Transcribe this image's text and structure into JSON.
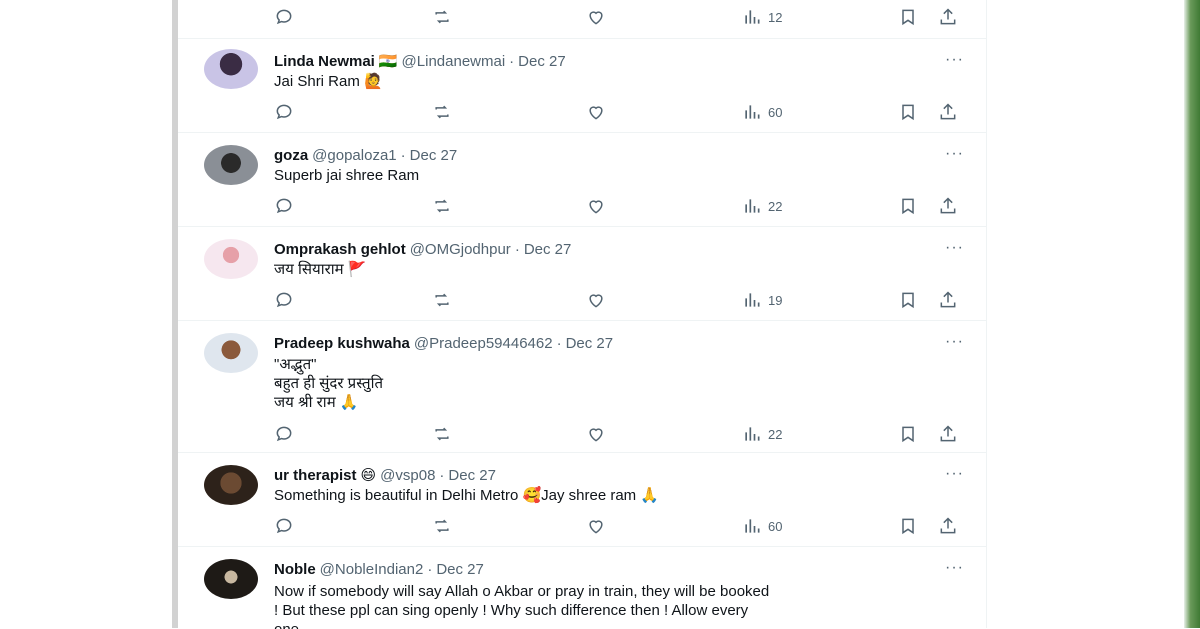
{
  "top_row": {
    "views": "12"
  },
  "posts": [
    {
      "name": "Linda Newmai",
      "badge": "🇮🇳",
      "handle": "@Lindanewmai",
      "date": "Dec 27",
      "text": "Jai Shri Ram 🙋",
      "views": "60"
    },
    {
      "name": "goza",
      "badge": "",
      "handle": "@gopaloza1",
      "date": "Dec 27",
      "text": "Superb jai shree Ram",
      "views": "22"
    },
    {
      "name": "Omprakash gehlot",
      "badge": "",
      "handle": "@OMGjodhpur",
      "date": "Dec 27",
      "text": "जय सियाराम 🚩",
      "views": "19"
    },
    {
      "name": "Pradeep kushwaha",
      "badge": "",
      "handle": "@Pradeep59446462",
      "date": "Dec 27",
      "text": "\"अद्भुत\"\nबहुत ही सुंदर प्रस्तुति\nजय श्री राम 🙏",
      "views": "22"
    },
    {
      "name": "ur therapist",
      "badge": "😄",
      "handle": "@vsp08",
      "date": "Dec 27",
      "text": "Something is beautiful in Delhi Metro 🥰Jay shree ram 🙏",
      "views": "60"
    },
    {
      "name": "Noble",
      "badge": "",
      "handle": "@NobleIndian2",
      "date": "Dec 27",
      "text": "Now if somebody will say Allah o Akbar or pray in train, they will be booked\n! But these ppl can sing openly ! Why such difference then ! Allow every\none",
      "views": ""
    }
  ],
  "separator": "·",
  "more_glyph": "···",
  "icons": [
    "reply-icon",
    "repost-icon",
    "like-icon",
    "views-icon",
    "bookmark-icon",
    "share-icon"
  ],
  "colors": {
    "text": "#0f1419",
    "muted": "#536471",
    "divider": "#eff3f4"
  }
}
